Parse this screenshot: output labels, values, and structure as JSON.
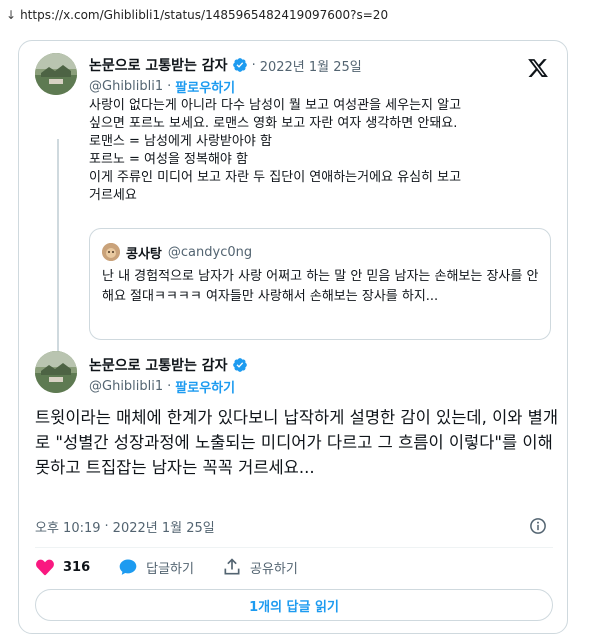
{
  "url_bar": {
    "url": "https://x.com/Ghiblibli1/status/1485965482419097600?s=20"
  },
  "quoted_parent_tweet": {
    "display_name": "논문으로 고통받는 감자",
    "handle": "@Ghiblibli1",
    "follow_label": "팔로우하기",
    "separator": "·",
    "timestamp": "2022년 1월 25일",
    "text": "사랑이 없다는게 아니라 다수 남성이 뭘 보고 여성관을 세우는지 알고\n싶으면 포르노 보세요. 로맨스 영화 보고 자란 여자 생각하면 안돼요.\n로맨스 = 남성에게 사랑받아야 함\n포르노 = 여성을 정복해야 함\n이게 주류인 미디어 보고 자란 두 집단이 연애하는거에요 유심히 보고\n거르세요",
    "quote": {
      "name": "콩사탕",
      "handle": "@candyc0ng",
      "text": "난 내 경험적으로 남자가 사랑 어쩌고 하는 말 안 믿음 남자는 손해보는 장사를 안해요 절대ㅋㅋㅋㅋ 여자들만 사랑해서 손해보는 장사를 하지..."
    }
  },
  "main_tweet": {
    "display_name": "논문으로 고통받는 감자",
    "handle": "@Ghiblibli1",
    "follow_label": "팔로우하기",
    "separator": "·",
    "text": "트윗이라는 매체에 한계가 있다보니 납작하게 설명한 감이 있는데, 이와 별개로 \"성별간 성장과정에 노출되는 미디어가 다르고 그 흐름이 이렇다\"를 이해 못하고 트집잡는 남자는 꼭꼭 거르세요...",
    "time": "오후 10:19",
    "date": "2022년 1월 25일"
  },
  "actions": {
    "like_count": "316",
    "reply_label": "답글하기",
    "share_label": "공유하기"
  },
  "read_replies_label": "1개의 답글 읽기",
  "icons": {
    "verified": "verified-badge-icon",
    "x_logo": "x-logo-icon",
    "info": "info-icon",
    "like": "heart-icon",
    "reply": "reply-bubble-icon",
    "share": "share-upload-icon"
  },
  "colors": {
    "accent": "#1d9bf0",
    "like": "#f91880",
    "border": "#cfd9de",
    "muted": "#536471"
  }
}
